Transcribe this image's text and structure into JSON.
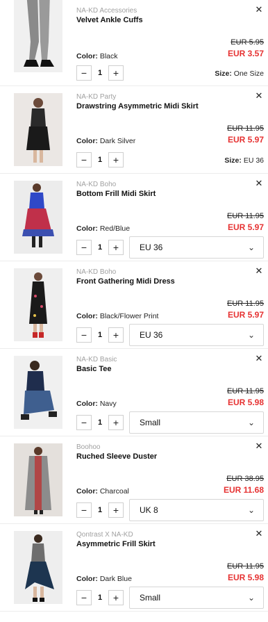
{
  "cart": {
    "items": [
      {
        "brand": "NA-KD Accessories",
        "name": "Velvet Ankle Cuffs",
        "color_label": "Color:",
        "color": "Black",
        "old_price": "EUR 5.95",
        "new_price": "EUR 3.57",
        "quantity": "1",
        "size_label": "Size:",
        "size": "One Size",
        "size_is_dropdown": false,
        "image_tone": "#d9d9d9"
      },
      {
        "brand": "NA-KD Party",
        "name": "Drawstring Asymmetric Midi Skirt",
        "color_label": "Color:",
        "color": "Dark Silver",
        "old_price": "EUR 11.95",
        "new_price": "EUR 5.97",
        "quantity": "1",
        "size_label": "Size:",
        "size": "EU 36",
        "size_is_dropdown": false,
        "image_tone": "#e7e3e0"
      },
      {
        "brand": "NA-KD Boho",
        "name": "Bottom Frill Midi Skirt",
        "color_label": "Color:",
        "color": "Red/Blue",
        "old_price": "EUR 11.95",
        "new_price": "EUR 5.97",
        "quantity": "1",
        "size": "EU 36",
        "size_is_dropdown": true,
        "image_tone": "#eaeaea"
      },
      {
        "brand": "NA-KD Boho",
        "name": "Front Gathering Midi Dress",
        "color_label": "Color:",
        "color": "Black/Flower Print",
        "old_price": "EUR 11.95",
        "new_price": "EUR 5.97",
        "quantity": "1",
        "size": "EU 36",
        "size_is_dropdown": true,
        "image_tone": "#ededed"
      },
      {
        "brand": "NA-KD Basic",
        "name": "Basic Tee",
        "color_label": "Color:",
        "color": "Navy",
        "old_price": "EUR 11.95",
        "new_price": "EUR 5.98",
        "quantity": "1",
        "size": "Small",
        "size_is_dropdown": true,
        "image_tone": "#eeeeee"
      },
      {
        "brand": "Boohoo",
        "name": "Ruched Sleeve Duster",
        "color_label": "Color:",
        "color": "Charcoal",
        "old_price": "EUR 38.95",
        "new_price": "EUR 11.68",
        "quantity": "1",
        "size": "UK 8",
        "size_is_dropdown": true,
        "image_tone": "#e6e3df"
      },
      {
        "brand": "Qontrast X NA-KD",
        "name": "Asymmetric Frill Skirt",
        "color_label": "Color:",
        "color": "Dark Blue",
        "old_price": "EUR 11.95",
        "new_price": "EUR 5.98",
        "quantity": "1",
        "size": "Small",
        "size_is_dropdown": true,
        "image_tone": "#eeeeee"
      }
    ],
    "icons": {
      "remove": "close-icon",
      "decrement": "minus-icon",
      "increment": "plus-icon",
      "dropdown": "chevron-down-icon"
    },
    "colors": {
      "sale_price": "#e63232",
      "brand_text": "#a0a0a0"
    }
  }
}
